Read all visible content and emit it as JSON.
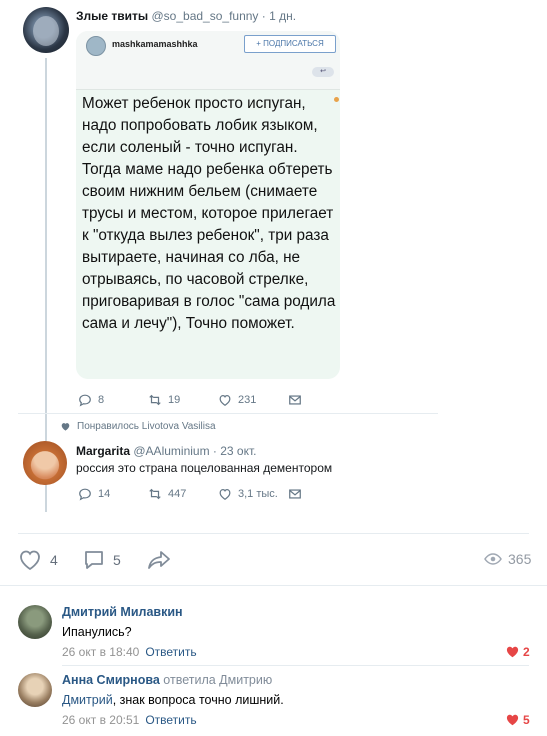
{
  "tweet": {
    "author_name": "Злые твиты",
    "author_handle": "@so_bad_so_funny",
    "time": "· 1 дн.",
    "card": {
      "username": "mashkamamashhka",
      "subscribe": "+ ПОДПИСАТЬСЯ",
      "text": "Может ребенок просто испуган, надо попробовать лобик языком, если соленый - точно испуган. Тогда маме надо ребенка обтереть своим нижним бельем (снимаете трусы и местом, которое прилегает к \"откуда вылез ребенок\", три раза вытираете, начиная со лба, не отрываясь, по часовой стрелке, приговаривая в голос \"сама родила сама и лечу\"), Точно поможет."
    },
    "stats": {
      "replies": "8",
      "retweets": "19",
      "likes": "231"
    }
  },
  "liked_by": "Понравилось Livotova Vasilisa",
  "reply_tweet": {
    "author_name": "Margarita",
    "author_handle": "@AAluminium",
    "time": "· 23 окт.",
    "text": "россия это страна поцелованная дементором",
    "stats": {
      "replies": "14",
      "retweets": "447",
      "likes": "3,1 тыс."
    }
  },
  "post_stats": {
    "likes": "4",
    "comments": "5",
    "views": "365"
  },
  "comments": [
    {
      "author": "Дмитрий Милавкин",
      "text": "Ипанулись?",
      "date": "26 окт в 18:40",
      "reply_label": "Ответить",
      "likes": "2"
    },
    {
      "author": "Анна Смирнова",
      "reply_to": "ответила Дмитрию",
      "mention": "Дмитрий",
      "text": ", знак вопроса точно лишний.",
      "date": "26 окт в 20:51",
      "reply_label": "Ответить",
      "likes": "5"
    }
  ],
  "colors": {
    "link": "#2a5885",
    "like_red": "#e64646",
    "muted": "#657786"
  }
}
